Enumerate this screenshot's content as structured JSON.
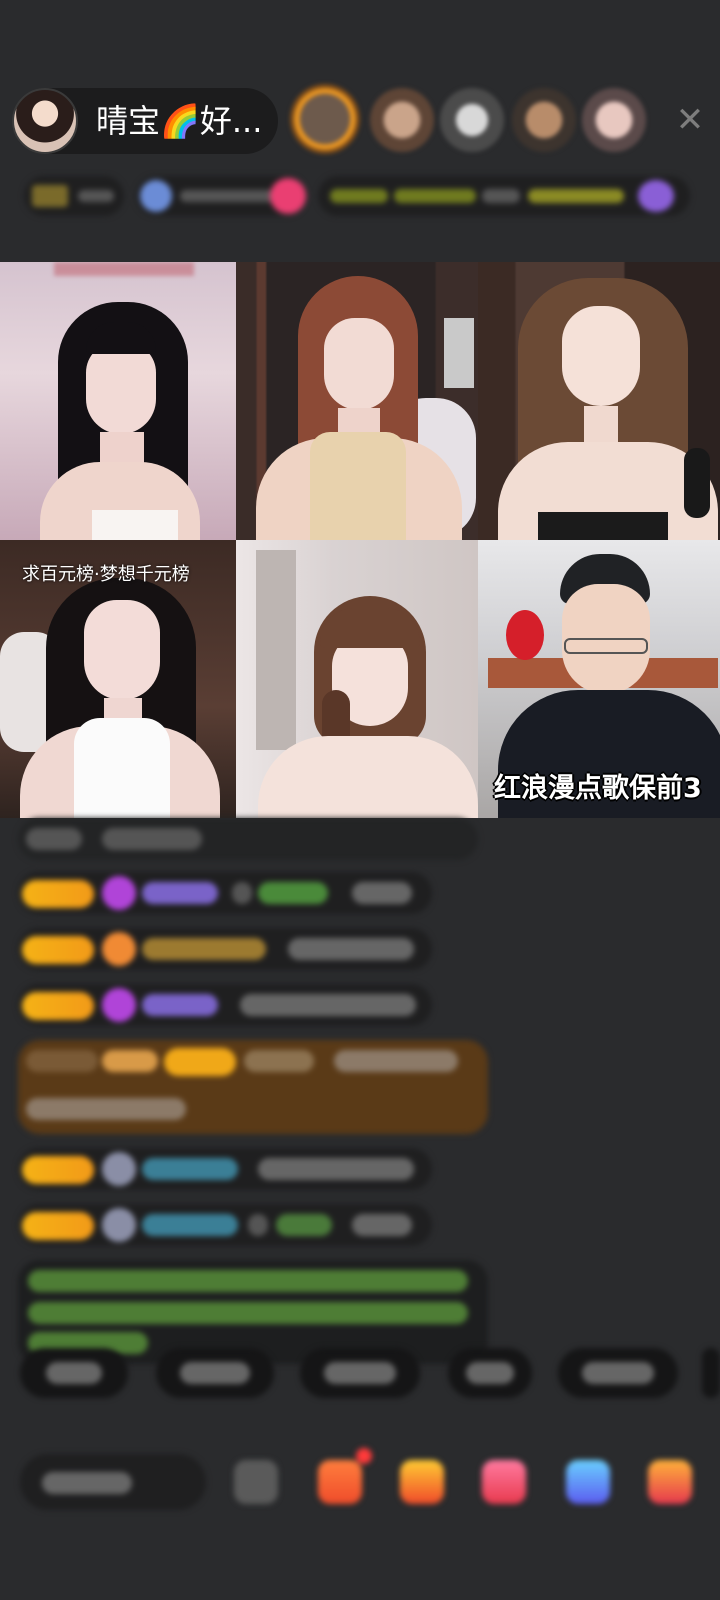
{
  "header": {
    "host_name": "晴宝🌈好...",
    "close_icon": "close-icon"
  },
  "grid": {
    "cells": [
      {
        "label": ""
      },
      {
        "label": ""
      },
      {
        "label": ""
      },
      {
        "label": "求百元榜·梦想千元榜"
      },
      {
        "label": ""
      },
      {
        "label": "红浪漫点歌保前3"
      }
    ]
  },
  "icons": {
    "close": "close-icon",
    "gift": "gift-box-icon",
    "emoji": "emoji-icon"
  },
  "colors": {
    "background": "#2a2b2d",
    "badge_gold": "#f5b216",
    "chat_green": "#7bd449",
    "chat_cyan": "#4cc2e0",
    "chat_highlight": "#5a3a17"
  }
}
